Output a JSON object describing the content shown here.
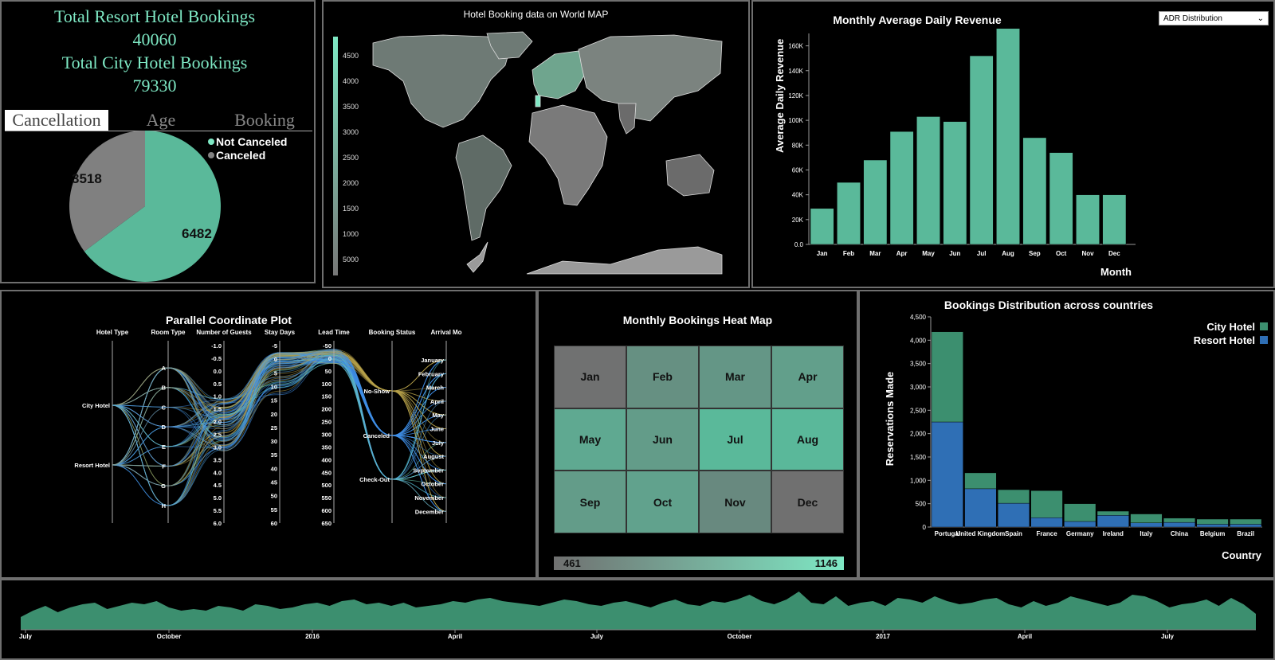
{
  "summary": {
    "resort_label": "Total Resort Hotel Bookings",
    "resort_value": "40060",
    "city_label": "Total City Hotel Bookings",
    "city_value": "79330",
    "tabs": [
      "Cancellation",
      "Age",
      "Booking"
    ]
  },
  "pie": {
    "legend": [
      "Not Canceled",
      "Canceled"
    ],
    "values": [
      6482,
      3518
    ],
    "labels": [
      "6482",
      "3518"
    ],
    "colors": [
      "#5ab99a",
      "#808080"
    ]
  },
  "map": {
    "title": "Hotel Booking data on World MAP",
    "scale_ticks": [
      "4500",
      "4000",
      "3500",
      "3000",
      "2500",
      "2000",
      "1500",
      "1000",
      "5000"
    ]
  },
  "adr": {
    "dropdown": "ADR Distribution",
    "xlabel": "Month",
    "ylabel": "Average Daily Revenue"
  },
  "parallel": {
    "title": "Parallel Coordinate Plot",
    "axes": [
      "Hotel Type",
      "Room Type",
      "Number of Guests",
      "Stay Days",
      "Lead Time",
      "Booking Status",
      "Arrival Mo"
    ],
    "hotel_types": [
      "City Hotel",
      "Resort Hotel"
    ],
    "room_types": [
      "A",
      "B",
      "C",
      "D",
      "E",
      "F",
      "G",
      "H"
    ],
    "guest_ticks": [
      "-1.0",
      "-0.5",
      "0.0",
      "0.5",
      "1.0",
      "1.5",
      "2.0",
      "2.5",
      "3.0",
      "3.5",
      "4.0",
      "4.5",
      "5.0",
      "5.5",
      "6.0"
    ],
    "stay_ticks": [
      "-5",
      "0",
      "5",
      "10",
      "15",
      "20",
      "25",
      "30",
      "35",
      "40",
      "45",
      "50",
      "55",
      "60"
    ],
    "lead_ticks": [
      "-50",
      "0",
      "50",
      "100",
      "150",
      "200",
      "250",
      "300",
      "350",
      "400",
      "450",
      "500",
      "550",
      "600",
      "650"
    ],
    "status": [
      "No-Show",
      "Canceled",
      "Check-Out"
    ],
    "months": [
      "January",
      "February",
      "March",
      "April",
      "May",
      "June",
      "July",
      "August",
      "September",
      "October",
      "November",
      "December"
    ]
  },
  "heatmap": {
    "title": "Monthly Bookings Heat Map",
    "months": [
      "Jan",
      "Feb",
      "Mar",
      "Apr",
      "May",
      "Jun",
      "Jul",
      "Aug",
      "Sep",
      "Oct",
      "Nov",
      "Dec"
    ],
    "min_label": "461",
    "max_label": "1146"
  },
  "timeline": {
    "ticks": [
      "July",
      "October",
      "2016",
      "April",
      "July",
      "October",
      "2017",
      "April",
      "July"
    ]
  },
  "chart_data": [
    {
      "type": "pie",
      "categories": [
        "Not Canceled",
        "Canceled"
      ],
      "values": [
        6482,
        3518
      ]
    },
    {
      "type": "bar",
      "title": "Monthly Average Daily Revenue",
      "categories": [
        "Jan",
        "Feb",
        "Mar",
        "Apr",
        "May",
        "Jun",
        "Jul",
        "Aug",
        "Sep",
        "Oct",
        "Nov",
        "Dec"
      ],
      "values": [
        29000,
        50000,
        68000,
        91000,
        103000,
        99000,
        152000,
        174000,
        86000,
        74000,
        40000,
        40000
      ],
      "xlabel": "Month",
      "ylabel": "Average Daily Revenue",
      "ylim": [
        0,
        170000
      ],
      "yticks": [
        "0.0",
        "20K",
        "40K",
        "60K",
        "80K",
        "100K",
        "120K",
        "140K",
        "160K"
      ],
      "ytick_values": [
        0,
        20000,
        40000,
        60000,
        80000,
        100000,
        120000,
        140000,
        160000
      ]
    },
    {
      "type": "heatmap",
      "title": "Monthly Bookings Heat Map",
      "categories": [
        "Jan",
        "Feb",
        "Mar",
        "Apr",
        "May",
        "Jun",
        "Jul",
        "Aug",
        "Sep",
        "Oct",
        "Nov",
        "Dec"
      ],
      "values": [
        470,
        760,
        820,
        900,
        1000,
        870,
        1146,
        1140,
        870,
        930,
        700,
        461
      ],
      "range": [
        461,
        1146
      ]
    },
    {
      "type": "bar",
      "title": "Bookings Distribution across countries",
      "categories": [
        "Portugal",
        "United Kingdom",
        "Spain",
        "France",
        "Germany",
        "Ireland",
        "Italy",
        "China",
        "Belgium",
        "Brazil"
      ],
      "tick_labels": [
        "Portugal",
        "United Kingdom",
        "Spain",
        "France",
        "Germany",
        "Ireland",
        "Italy",
        "China",
        "Belgium",
        "Brazil"
      ],
      "series": [
        {
          "name": "Resort Hotel",
          "values": [
            2250,
            820,
            510,
            200,
            120,
            250,
            90,
            100,
            60,
            60
          ],
          "color": "#2f6fb5"
        },
        {
          "name": "City Hotel",
          "values": [
            1930,
            340,
            290,
            580,
            380,
            90,
            190,
            90,
            110,
            110
          ],
          "color": "#3c8f6f"
        }
      ],
      "xlabel": "Country",
      "ylabel": "Reservations Made",
      "ylim": [
        0,
        4500
      ],
      "yticks": [
        "0",
        "500",
        "1,000",
        "1,500",
        "2,000",
        "2,500",
        "3,000",
        "3,500",
        "4,000",
        "4,500"
      ],
      "ytick_values": [
        0,
        500,
        1000,
        1500,
        2000,
        2500,
        3000,
        3500,
        4000,
        4500
      ]
    },
    {
      "type": "area",
      "values": [
        8,
        12,
        15,
        11,
        14,
        16,
        17,
        13,
        15,
        17,
        16,
        18,
        14,
        12,
        13,
        12,
        15,
        14,
        12,
        16,
        15,
        13,
        14,
        16,
        17,
        15,
        18,
        19,
        16,
        17,
        15,
        17,
        14,
        15,
        16,
        18,
        17,
        19,
        20,
        18,
        17,
        16,
        15,
        17,
        19,
        18,
        16,
        15,
        17,
        18,
        16,
        14,
        17,
        19,
        16,
        15,
        18,
        17,
        19,
        22,
        18,
        16,
        19,
        24,
        17,
        16,
        21,
        15,
        17,
        18,
        15,
        20,
        19,
        17,
        21,
        18,
        16,
        17,
        19,
        20,
        16,
        14,
        18,
        15,
        17,
        21,
        19,
        17,
        15,
        17,
        22,
        21,
        18,
        14,
        16,
        17,
        19,
        15,
        20,
        16,
        10
      ]
    }
  ]
}
